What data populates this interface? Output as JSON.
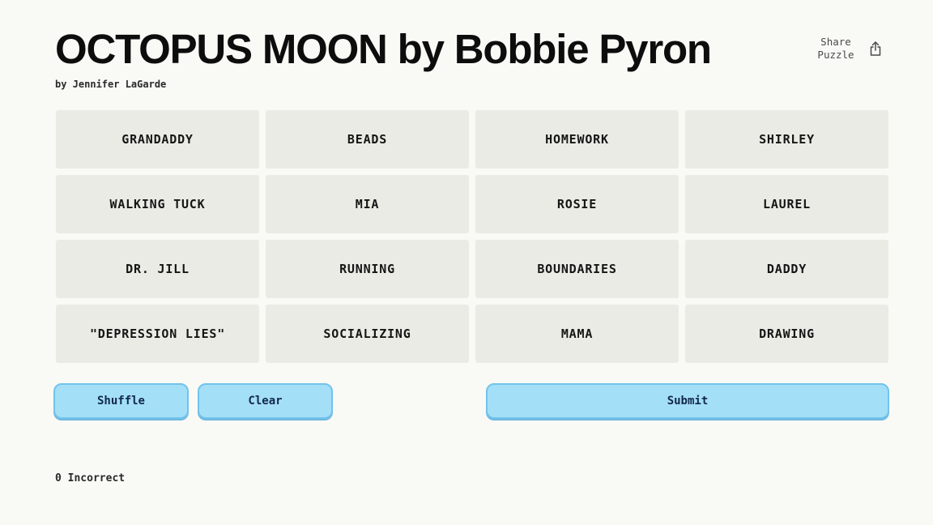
{
  "header": {
    "title": "OCTOPUS MOON by Bobbie Pyron",
    "byline": "by Jennifer LaGarde",
    "share": {
      "line1": "Share",
      "line2": "Puzzle",
      "icon": "share-icon"
    }
  },
  "grid": {
    "tiles": [
      "GRANDADDY",
      "BEADS",
      "HOMEWORK",
      "SHIRLEY",
      "WALKING TUCK",
      "MIA",
      "ROSIE",
      "LAUREL",
      "DR. JILL",
      "RUNNING",
      "BOUNDARIES",
      "DADDY",
      "\"DEPRESSION LIES\"",
      "SOCIALIZING",
      "MAMA",
      "DRAWING"
    ]
  },
  "controls": {
    "shuffle_label": "Shuffle",
    "clear_label": "Clear",
    "submit_label": "Submit"
  },
  "status": {
    "incorrect": "0 Incorrect"
  },
  "colors": {
    "background": "#f9f9f5",
    "tile": "#ebebe5",
    "button": "#a4dff8",
    "button_border": "#72c3ec",
    "button_text": "#13294b"
  }
}
